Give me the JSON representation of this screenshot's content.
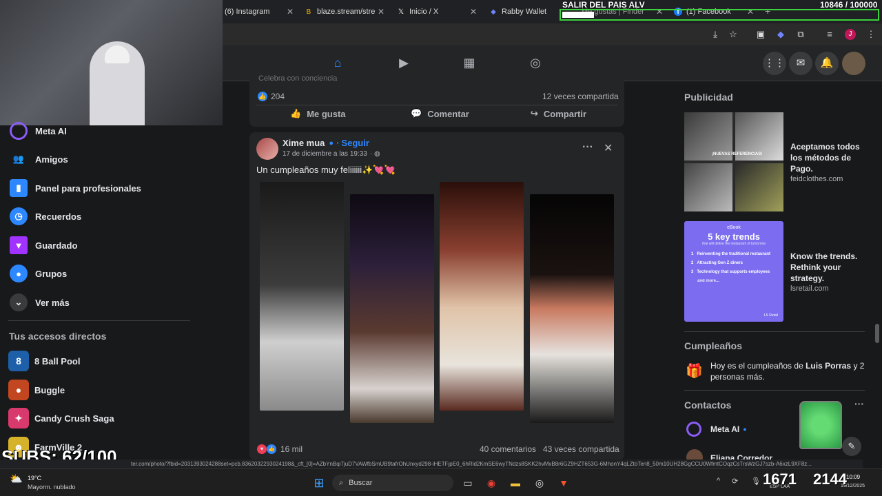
{
  "tabs": [
    {
      "label": "(6) Instagram",
      "icon": "instagram-icon"
    },
    {
      "label": "blaze.stream/stre",
      "icon": "blaze-icon"
    },
    {
      "label": "Inicio / X",
      "icon": "x-logo-icon"
    },
    {
      "label": "Rabby Wallet",
      "icon": "rabby-icon"
    },
    {
      "label": "Me gustas | Finder",
      "icon": "finder-icon"
    },
    {
      "label": "(1) Facebook",
      "icon": "facebook-icon"
    }
  ],
  "overlay": {
    "banner": "SALIR DEL PAIS ALV",
    "counter": "10846 / 100000",
    "subs": "SUBS: 62/100"
  },
  "sidebar": {
    "items": [
      {
        "label": "Meta AI"
      },
      {
        "label": "Amigos"
      },
      {
        "label": "Panel para profesionales"
      },
      {
        "label": "Recuerdos"
      },
      {
        "label": "Guardado"
      },
      {
        "label": "Grupos"
      },
      {
        "label": "Ver más"
      }
    ],
    "shortcuts_title": "Tus accesos directos",
    "shortcuts": [
      {
        "label": "8 Ball Pool"
      },
      {
        "label": "Buggle"
      },
      {
        "label": "Candy Crush Saga"
      },
      {
        "label": "FarmVille 2"
      }
    ]
  },
  "prev_post": {
    "caption_fragment": "Celebra con conciencia",
    "reactions": "204",
    "shares": "12 veces compartida",
    "actions": {
      "like": "Me gusta",
      "comment": "Comentar",
      "share": "Compartir"
    }
  },
  "post": {
    "author": "Xime mua",
    "follow": "Seguir",
    "date": "17 de diciembre a las 19:33",
    "text": "Un cumpleaños muy feliiiiii✨💘💘",
    "reactions": "16 mil",
    "comments": "40 comentarios",
    "shares": "43 veces compartida"
  },
  "right": {
    "ads_title": "Publicidad",
    "ads": [
      {
        "headline": "Aceptamos todos los métodos de Pago.",
        "domain": "feidclothes.com",
        "image_text": "¡NUEVAS REFERENCIAS!"
      },
      {
        "headline": "Know the trends. Rethink your strategy.",
        "domain": "lsretail.com"
      }
    ],
    "ebook": {
      "tag": "eBook",
      "title": "5 key trends",
      "subtitle": "that will define the restaurant of tomorrow",
      "items": [
        "Reinventing the traditional restaurant",
        "Attracting Gen Z diners",
        "Technology that supports employees"
      ],
      "more": "and more...",
      "brand": "LS Retail"
    },
    "birthdays_title": "Cumpleaños",
    "birthday_text_pre": "Hoy es el cumpleaños de ",
    "birthday_name": "Luis Porras",
    "birthday_text_post": " y 2 personas más.",
    "contacts_title": "Contactos",
    "contacts": [
      {
        "name": "Meta AI"
      },
      {
        "name": "Eliana Corredor"
      }
    ]
  },
  "status_url": "ter.com/photo/?fbid=2031393024288set=pcb.8362032293024198&_cft_[0]=AZbYnBqi7juD7VAWfbSmUB9tafrOhUnxyd298-iHETFjpE0_6hRld2KmSE6wyTNdzs8SKK2hvMxB8r6GZ9HZT653G-6MhonY4qLZtoTen8_50m10UH28GgCCU0WfmtCOqzCsTrsWzGJ7szb-A6xzL9XF8z...",
  "taskbar": {
    "weather_temp": "19°C",
    "weather_desc": "Mayorm. nublado",
    "search": "Buscar",
    "time": "10:09",
    "date": "19/12/2025",
    "lang": "ESP LAA"
  },
  "stream_overlay": {
    "left_counter": "1671",
    "right_counter": "2144"
  }
}
